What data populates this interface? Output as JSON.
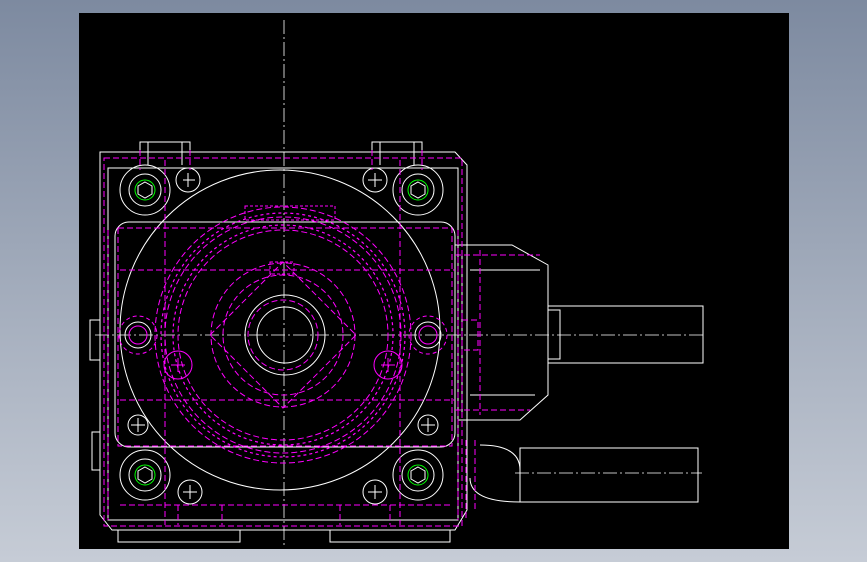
{
  "window": {
    "background_top": "#7d8aa0",
    "background_bottom": "#c6ccd6"
  },
  "drawing": {
    "canvas_color": "#000000",
    "line_colors": {
      "visible_edge": "#ffffff",
      "hidden_edge": "#ff00ff",
      "thread": "#00ff00"
    }
  }
}
